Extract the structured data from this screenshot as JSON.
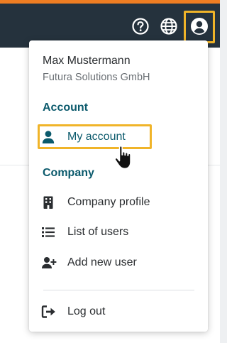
{
  "colors": {
    "topbar": "#25323d",
    "accent_orange": "#ef7d22",
    "highlight": "#f0b429",
    "section_teal": "#0b5a6c",
    "text": "#2a2d30",
    "muted": "#6a6f74"
  },
  "header": {
    "icons": [
      "help-circle-icon",
      "globe-icon",
      "account-circle-icon"
    ]
  },
  "user": {
    "name": "Max Mustermann",
    "company": "Futura Solutions GmbH"
  },
  "account_section": {
    "heading": "Account",
    "items": [
      {
        "label": "My account",
        "icon": "user-icon"
      }
    ]
  },
  "company_section": {
    "heading": "Company",
    "items": [
      {
        "label": "Company profile",
        "icon": "building-icon"
      },
      {
        "label": "List of users",
        "icon": "list-icon"
      },
      {
        "label": "Add new user",
        "icon": "add-user-icon"
      }
    ]
  },
  "logout": {
    "label": "Log out",
    "icon": "logout-icon"
  }
}
